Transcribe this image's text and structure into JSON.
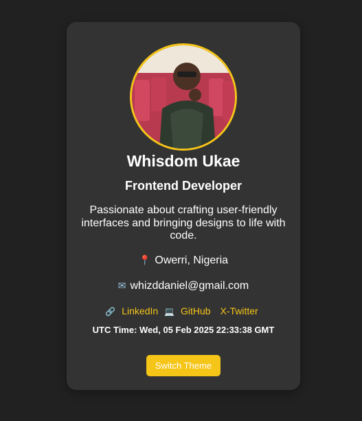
{
  "profile": {
    "avatar_alt": "profile photo",
    "name": "Whisdom Ukae",
    "role": "Frontend Developer",
    "bio": "Passionate about crafting user-friendly interfaces and bringing designs to life with code.",
    "location_icon": "pin-icon",
    "location": "Owerri, Nigeria",
    "email_icon": "email-icon",
    "email": "whizddaniel@gmail.com"
  },
  "links": {
    "linkedin_icon": "link-icon",
    "linkedin_label": "LinkedIn",
    "github_icon": "laptop-icon",
    "github_label": "GitHub",
    "twitter_label": "X-Twitter"
  },
  "utc_time": "UTC Time: Wed, 05 Feb 2025 22:33:38 GMT",
  "theme_button_label": "Switch Theme",
  "colors": {
    "background": "#212121",
    "card": "#333333",
    "accent": "#f5c518",
    "text": "#ffffff"
  }
}
